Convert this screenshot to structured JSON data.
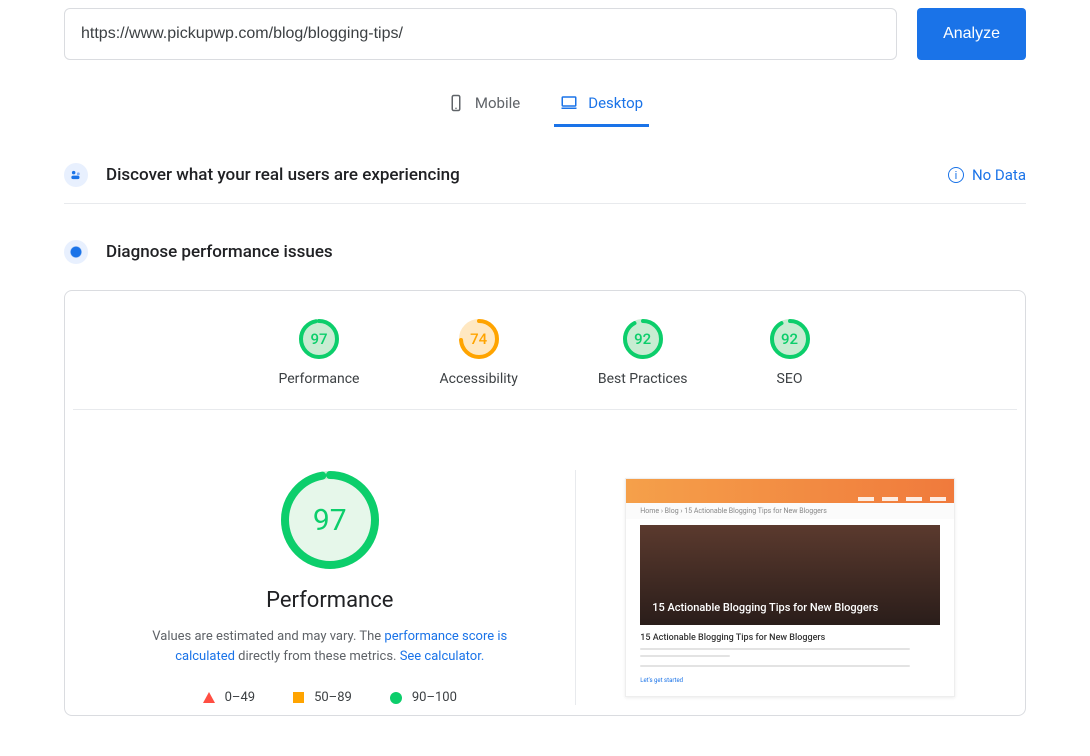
{
  "url_input": {
    "value": "https://www.pickupwp.com/blog/blogging-tips/"
  },
  "analyze_button": "Analyze",
  "tabs": {
    "mobile": "Mobile",
    "desktop": "Desktop",
    "active": "desktop"
  },
  "sections": {
    "discover": "Discover what your real users are experiencing",
    "no_data": "No Data",
    "diagnose": "Diagnose performance issues"
  },
  "gauges": [
    {
      "label": "Performance",
      "score": 97,
      "color": "#0cce6b"
    },
    {
      "label": "Accessibility",
      "score": 74,
      "color": "#ffa400"
    },
    {
      "label": "Best Practices",
      "score": 92,
      "color": "#0cce6b"
    },
    {
      "label": "SEO",
      "score": 92,
      "color": "#0cce6b"
    }
  ],
  "performance_detail": {
    "score": 97,
    "title": "Performance",
    "desc_prefix": "Values are estimated and may vary. The ",
    "link1": "performance score is calculated",
    "desc_mid": " directly from these metrics. ",
    "link2": "See calculator."
  },
  "legend": {
    "poor": "0–49",
    "avg": "50–89",
    "good": "90–100"
  },
  "screenshot": {
    "breadcrumb": "Home  ›  Blog  ›  15 Actionable Blogging Tips for New Bloggers",
    "hero": "15 Actionable Blogging Tips for New Bloggers",
    "heading": "15 Actionable Blogging Tips for New Bloggers",
    "cta": "Let's get started"
  }
}
